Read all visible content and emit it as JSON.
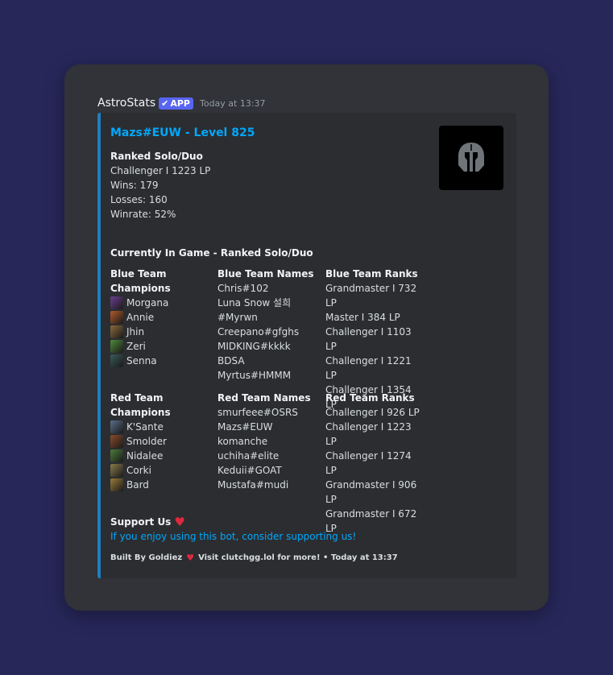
{
  "message": {
    "bot_name": "AstroStats",
    "badge_label": "APP",
    "timestamp": "Today at 13:37"
  },
  "embed": {
    "title": "Mazs#EUW - Level 825",
    "accent_color": "#1f80c0",
    "thumbnail_icon": "spartan-helmet-icon",
    "ranked": {
      "label": "Ranked Solo/Duo",
      "rank": "Challenger I 1223 LP",
      "wins": "Wins: 179",
      "losses": "Losses: 160",
      "winrate": "Winrate: 52%"
    },
    "in_game": {
      "label": "Currently In Game - Ranked Solo/Duo",
      "blue": {
        "champions_header": "Blue Team Champions",
        "names_header": "Blue Team Names",
        "ranks_header": "Blue Team Ranks",
        "champions": [
          {
            "name": "Morgana",
            "color": "#6b3f8f"
          },
          {
            "name": "Annie",
            "color": "#b35a2a"
          },
          {
            "name": "Jhin",
            "color": "#8a6a3a"
          },
          {
            "name": "Zeri",
            "color": "#4f8a3a"
          },
          {
            "name": "Senna",
            "color": "#3a5a5a"
          }
        ],
        "names": [
          "Chris#102",
          "Luna Snow 설희 #Myrwn",
          "Creepano#gfghs",
          "MIDKING#kkkk",
          "BDSA",
          "Myrtus#HMMM"
        ],
        "ranks": [
          "Grandmaster I 732 LP",
          "Master I 384 LP",
          "Challenger I 1103 LP",
          "Challenger I 1221 LP",
          "Challenger I 1354 LP"
        ]
      },
      "red": {
        "champions_header": "Red Team Champions",
        "names_header": "Red Team Names",
        "ranks_header": "Red Team Ranks",
        "champions": [
          {
            "name": "K'Sante",
            "color": "#5a6f8a"
          },
          {
            "name": "Smolder",
            "color": "#8a4a2a"
          },
          {
            "name": "Nidalee",
            "color": "#4a7a3a"
          },
          {
            "name": "Corki",
            "color": "#8a7a4a"
          },
          {
            "name": "Bard",
            "color": "#9a7a3a"
          }
        ],
        "names": [
          "smurfeee#OSRS",
          "Mazs#EUW",
          "komanche",
          "uchiha#elite",
          "Keduii#GOAT",
          "Mustafa#mudi"
        ],
        "ranks": [
          "Challenger I 926 LP",
          "Challenger I 1223 LP",
          "Challenger I 1274 LP",
          "Grandmaster I 906 LP",
          "Grandmaster I 672 LP"
        ]
      }
    },
    "support": {
      "label": "Support Us",
      "emoji": "❤️",
      "link_text": "If you enjoy using this bot, consider supporting us!"
    },
    "footer": {
      "built_by": "Built By Goldiez",
      "heart": "❤️",
      "visit": "Visit clutchgg.lol for more! • Today at 13:37"
    }
  }
}
